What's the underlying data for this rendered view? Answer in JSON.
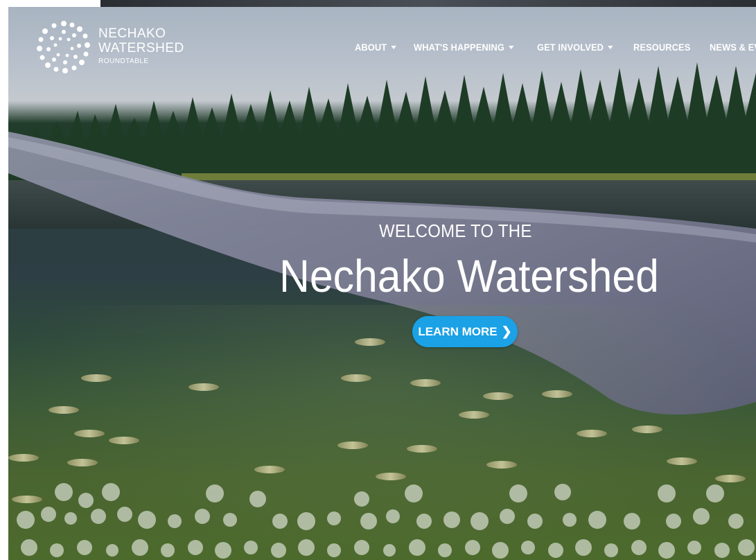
{
  "brand": {
    "line1": "NECHAKO",
    "line2": "WATERSHED",
    "line3": "ROUNDTABLE"
  },
  "nav": {
    "items": [
      {
        "label": "ABOUT",
        "has_dropdown": true
      },
      {
        "label": "WHAT'S HAPPENING",
        "has_dropdown": true
      },
      {
        "label": "GET INVOLVED",
        "has_dropdown": true
      },
      {
        "label": "RESOURCES",
        "has_dropdown": false
      },
      {
        "label": "NEWS & EVENTS",
        "has_dropdown": false
      }
    ]
  },
  "hero": {
    "eyebrow": "WELCOME TO THE",
    "title": "Nechako Watershed",
    "cta_label": "LEARN MORE",
    "cta_icon": "chevron-right-icon"
  },
  "colors": {
    "cta": "#1aa1e6",
    "text": "#ffffff"
  }
}
